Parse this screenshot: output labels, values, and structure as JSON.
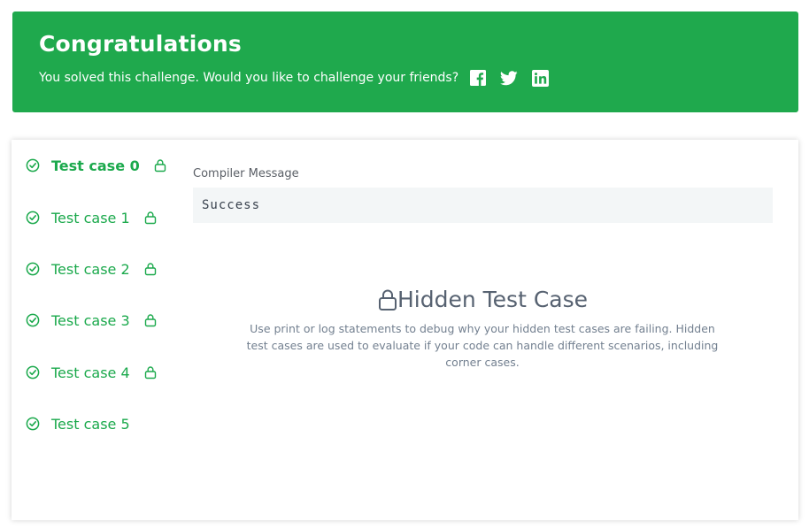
{
  "banner": {
    "title": "Congratulations",
    "message": "You solved this challenge. Would you like to challenge your friends?",
    "background_color": "#1fa94d",
    "share_icons": [
      "facebook-icon",
      "twitter-icon",
      "linkedin-icon"
    ]
  },
  "test_cases": [
    {
      "label": "Test case 0",
      "status": "passed",
      "locked": true,
      "active": true
    },
    {
      "label": "Test case 1",
      "status": "passed",
      "locked": true,
      "active": false
    },
    {
      "label": "Test case 2",
      "status": "passed",
      "locked": true,
      "active": false
    },
    {
      "label": "Test case 3",
      "status": "passed",
      "locked": true,
      "active": false
    },
    {
      "label": "Test case 4",
      "status": "passed",
      "locked": true,
      "active": false
    },
    {
      "label": "Test case 5",
      "status": "passed",
      "locked": false,
      "active": false
    }
  ],
  "compiler": {
    "label": "Compiler Message",
    "message": "Success"
  },
  "hidden_case": {
    "title": "Hidden Test Case",
    "description": "Use print or log statements to debug why your hidden test cases are failing. Hidden test cases are used to evaluate if your code can handle different scenarios, including corner cases."
  },
  "colors": {
    "success_green": "#1ba94c",
    "text_dark": "#39424e",
    "text_muted": "#738090"
  }
}
